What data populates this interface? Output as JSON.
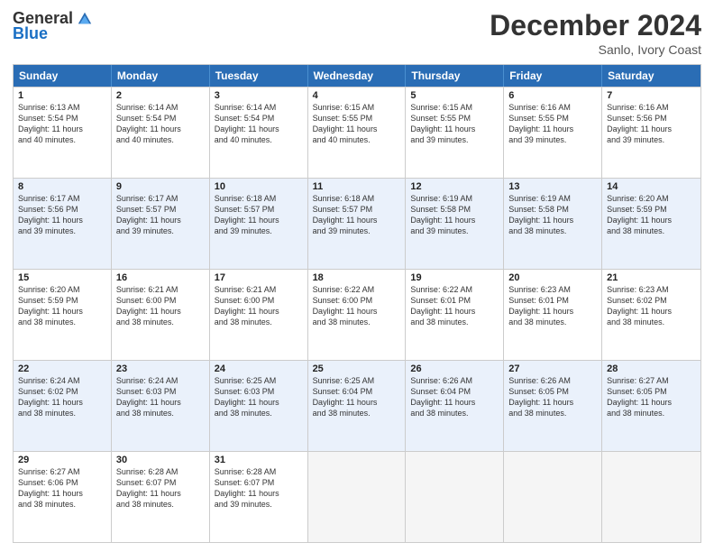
{
  "logo": {
    "general": "General",
    "blue": "Blue"
  },
  "title": "December 2024",
  "subtitle": "Sanlo, Ivory Coast",
  "header_days": [
    "Sunday",
    "Monday",
    "Tuesday",
    "Wednesday",
    "Thursday",
    "Friday",
    "Saturday"
  ],
  "weeks": [
    [
      {
        "day": "1",
        "info": "Sunrise: 6:13 AM\nSunset: 5:54 PM\nDaylight: 11 hours\nand 40 minutes."
      },
      {
        "day": "2",
        "info": "Sunrise: 6:14 AM\nSunset: 5:54 PM\nDaylight: 11 hours\nand 40 minutes."
      },
      {
        "day": "3",
        "info": "Sunrise: 6:14 AM\nSunset: 5:54 PM\nDaylight: 11 hours\nand 40 minutes."
      },
      {
        "day": "4",
        "info": "Sunrise: 6:15 AM\nSunset: 5:55 PM\nDaylight: 11 hours\nand 40 minutes."
      },
      {
        "day": "5",
        "info": "Sunrise: 6:15 AM\nSunset: 5:55 PM\nDaylight: 11 hours\nand 39 minutes."
      },
      {
        "day": "6",
        "info": "Sunrise: 6:16 AM\nSunset: 5:55 PM\nDaylight: 11 hours\nand 39 minutes."
      },
      {
        "day": "7",
        "info": "Sunrise: 6:16 AM\nSunset: 5:56 PM\nDaylight: 11 hours\nand 39 minutes."
      }
    ],
    [
      {
        "day": "8",
        "info": "Sunrise: 6:17 AM\nSunset: 5:56 PM\nDaylight: 11 hours\nand 39 minutes."
      },
      {
        "day": "9",
        "info": "Sunrise: 6:17 AM\nSunset: 5:57 PM\nDaylight: 11 hours\nand 39 minutes."
      },
      {
        "day": "10",
        "info": "Sunrise: 6:18 AM\nSunset: 5:57 PM\nDaylight: 11 hours\nand 39 minutes."
      },
      {
        "day": "11",
        "info": "Sunrise: 6:18 AM\nSunset: 5:57 PM\nDaylight: 11 hours\nand 39 minutes."
      },
      {
        "day": "12",
        "info": "Sunrise: 6:19 AM\nSunset: 5:58 PM\nDaylight: 11 hours\nand 39 minutes."
      },
      {
        "day": "13",
        "info": "Sunrise: 6:19 AM\nSunset: 5:58 PM\nDaylight: 11 hours\nand 38 minutes."
      },
      {
        "day": "14",
        "info": "Sunrise: 6:20 AM\nSunset: 5:59 PM\nDaylight: 11 hours\nand 38 minutes."
      }
    ],
    [
      {
        "day": "15",
        "info": "Sunrise: 6:20 AM\nSunset: 5:59 PM\nDaylight: 11 hours\nand 38 minutes."
      },
      {
        "day": "16",
        "info": "Sunrise: 6:21 AM\nSunset: 6:00 PM\nDaylight: 11 hours\nand 38 minutes."
      },
      {
        "day": "17",
        "info": "Sunrise: 6:21 AM\nSunset: 6:00 PM\nDaylight: 11 hours\nand 38 minutes."
      },
      {
        "day": "18",
        "info": "Sunrise: 6:22 AM\nSunset: 6:00 PM\nDaylight: 11 hours\nand 38 minutes."
      },
      {
        "day": "19",
        "info": "Sunrise: 6:22 AM\nSunset: 6:01 PM\nDaylight: 11 hours\nand 38 minutes."
      },
      {
        "day": "20",
        "info": "Sunrise: 6:23 AM\nSunset: 6:01 PM\nDaylight: 11 hours\nand 38 minutes."
      },
      {
        "day": "21",
        "info": "Sunrise: 6:23 AM\nSunset: 6:02 PM\nDaylight: 11 hours\nand 38 minutes."
      }
    ],
    [
      {
        "day": "22",
        "info": "Sunrise: 6:24 AM\nSunset: 6:02 PM\nDaylight: 11 hours\nand 38 minutes."
      },
      {
        "day": "23",
        "info": "Sunrise: 6:24 AM\nSunset: 6:03 PM\nDaylight: 11 hours\nand 38 minutes."
      },
      {
        "day": "24",
        "info": "Sunrise: 6:25 AM\nSunset: 6:03 PM\nDaylight: 11 hours\nand 38 minutes."
      },
      {
        "day": "25",
        "info": "Sunrise: 6:25 AM\nSunset: 6:04 PM\nDaylight: 11 hours\nand 38 minutes."
      },
      {
        "day": "26",
        "info": "Sunrise: 6:26 AM\nSunset: 6:04 PM\nDaylight: 11 hours\nand 38 minutes."
      },
      {
        "day": "27",
        "info": "Sunrise: 6:26 AM\nSunset: 6:05 PM\nDaylight: 11 hours\nand 38 minutes."
      },
      {
        "day": "28",
        "info": "Sunrise: 6:27 AM\nSunset: 6:05 PM\nDaylight: 11 hours\nand 38 minutes."
      }
    ],
    [
      {
        "day": "29",
        "info": "Sunrise: 6:27 AM\nSunset: 6:06 PM\nDaylight: 11 hours\nand 38 minutes."
      },
      {
        "day": "30",
        "info": "Sunrise: 6:28 AM\nSunset: 6:07 PM\nDaylight: 11 hours\nand 38 minutes."
      },
      {
        "day": "31",
        "info": "Sunrise: 6:28 AM\nSunset: 6:07 PM\nDaylight: 11 hours\nand 39 minutes."
      },
      {
        "day": "",
        "info": ""
      },
      {
        "day": "",
        "info": ""
      },
      {
        "day": "",
        "info": ""
      },
      {
        "day": "",
        "info": ""
      }
    ]
  ]
}
